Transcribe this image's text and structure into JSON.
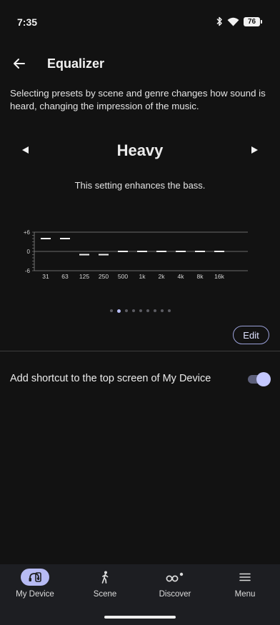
{
  "status_bar": {
    "time": "7:35",
    "battery": "76",
    "icons": [
      "bluetooth-icon",
      "wifi-icon",
      "battery-icon"
    ]
  },
  "header": {
    "title": "Equalizer",
    "back_icon": "arrow-left-icon"
  },
  "description": "Selecting presets by scene and genre changes how sound is heard, changing the impression of the music.",
  "preset": {
    "name": "Heavy",
    "description": "This setting enhances the bass.",
    "prev_icon": "triangle-left-icon",
    "next_icon": "triangle-right-icon"
  },
  "eq_chart": {
    "y_labels": [
      "+6",
      "0",
      "-6"
    ],
    "ylim": [
      -6,
      6
    ],
    "bands": [
      {
        "freq": "31",
        "gain": 4
      },
      {
        "freq": "63",
        "gain": 4
      },
      {
        "freq": "125",
        "gain": -1
      },
      {
        "freq": "250",
        "gain": -1
      },
      {
        "freq": "500",
        "gain": 0
      },
      {
        "freq": "1k",
        "gain": 0
      },
      {
        "freq": "2k",
        "gain": 0
      },
      {
        "freq": "4k",
        "gain": 0
      },
      {
        "freq": "8k",
        "gain": 0
      },
      {
        "freq": "16k",
        "gain": 0
      }
    ]
  },
  "pager": {
    "count": 9,
    "active_index": 1
  },
  "edit_label": "Edit",
  "shortcut": {
    "label": "Add shortcut to the top screen of My Device",
    "enabled": true
  },
  "bottom_nav": {
    "items": [
      {
        "label": "My Device",
        "icon": "headphones-device-icon",
        "active": true
      },
      {
        "label": "Scene",
        "icon": "walking-person-icon",
        "active": false
      },
      {
        "label": "Discover",
        "icon": "binoculars-icon",
        "active": false
      },
      {
        "label": "Menu",
        "icon": "hamburger-menu-icon",
        "active": false
      }
    ]
  },
  "colors": {
    "background": "#121212",
    "accent": "#b7bbf4",
    "nav_background": "#1d1e22"
  }
}
